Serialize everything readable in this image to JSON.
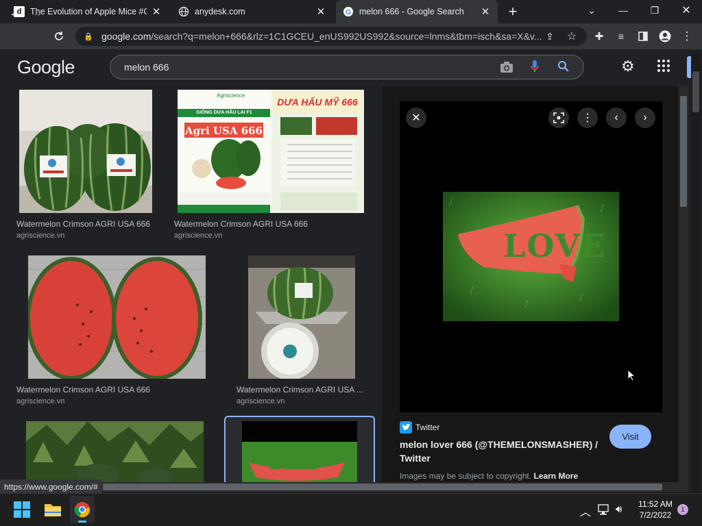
{
  "tabs": [
    {
      "title": "The Evolution of Apple Mice #Co",
      "favicon": "d"
    },
    {
      "title": "anydesk.com",
      "favicon": "globe-icon"
    },
    {
      "title": "melon 666 - Google Search",
      "favicon": "google-icon"
    }
  ],
  "omnibox": {
    "host": "google.com",
    "path": "/search?q=melon+666&rlz=1C1GCEU_enUS992US992&source=lnms&tbm=isch&sa=X&v..."
  },
  "google": {
    "logo": "Google",
    "query": "melon 666"
  },
  "results": [
    {
      "caption": "Watermelon Crimson AGRI USA 666",
      "source": "agriscience.vn"
    },
    {
      "caption": "Watermelon Crimson AGRI USA 666",
      "source": "agriscience.vn"
    },
    {
      "caption": "Watermelon Crimson AGRI USA 666",
      "source": "agriscience.vn"
    },
    {
      "caption": "Watermelon Crimson AGRI USA ...",
      "source": "agriscience.vn"
    }
  ],
  "packaging": {
    "brand": "Agriscience",
    "subtitle": "GIỐNG DƯA HẤU LAI F1",
    "product": "Agri USA 666",
    "right_title": "DƯA HẤU MỸ 666"
  },
  "preview": {
    "source": "Twitter",
    "title": "melon lover 666 (@THEMELONSMASHER) / Twitter",
    "visit": "Visit",
    "copyright": "Images may be subject to copyright.",
    "learn_more": "Learn More",
    "love_text": "LOVE"
  },
  "status_url": "https://www.google.com/#",
  "clock": {
    "time": "11:52 AM",
    "date": "7/2/2022",
    "notifications": "1"
  },
  "colors": {
    "accent": "#8ab4f8",
    "bg": "#202124"
  }
}
